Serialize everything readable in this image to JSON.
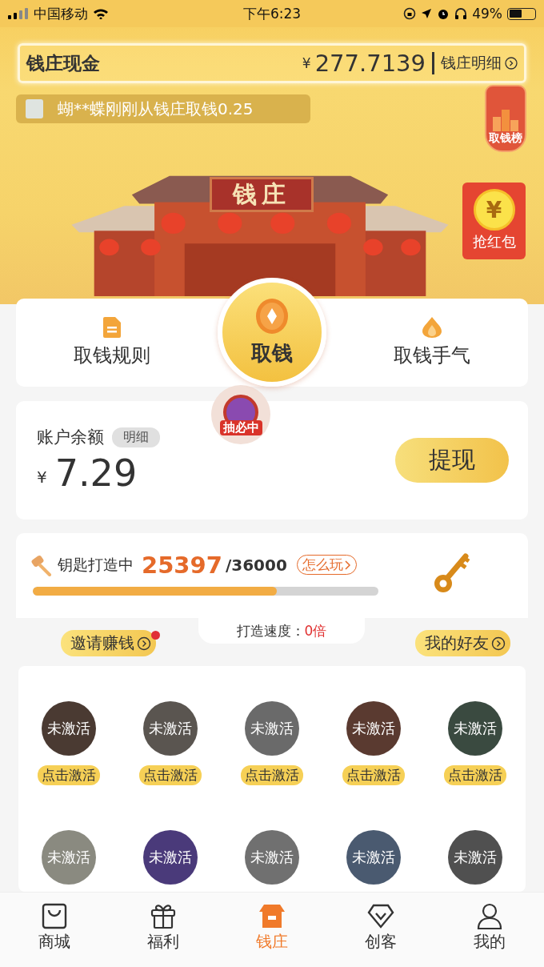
{
  "status_bar": {
    "carrier": "中国移动",
    "time": "下午6:23",
    "battery": "49%"
  },
  "header": {
    "title": "钱庄现金",
    "currency": "¥",
    "amount": "277.7139",
    "detail_link": "钱庄明细"
  },
  "ticker": {
    "text": "蝴**蝶刚刚从钱庄取钱0.25"
  },
  "rank_badge": {
    "label": "取钱榜"
  },
  "building": {
    "sign": "钱庄"
  },
  "red_packet": {
    "coin": "¥",
    "label": "抢红包"
  },
  "actions": [
    {
      "kind": "rules",
      "label": "取钱规则"
    },
    {
      "kind": "main",
      "label": "取钱"
    },
    {
      "kind": "luck",
      "label": "取钱手气"
    }
  ],
  "lottery_badge": {
    "label": "抽必中"
  },
  "balance": {
    "label": "账户余额",
    "detail": "明细",
    "currency": "¥",
    "amount": "7.29",
    "button": "提现"
  },
  "key_forge": {
    "title": "钥匙打造中",
    "current": "25397",
    "total": "/36000",
    "help": "怎么玩",
    "level": 0.7055,
    "speed_label": "打造速度：",
    "speed": "0倍"
  },
  "invite": {
    "label": "邀请赚钱",
    "has_dot": true
  },
  "friends_link": {
    "label": "我的好友"
  },
  "friends": [
    {
      "status": "未激活",
      "action": "点击激活"
    },
    {
      "status": "未激活",
      "action": "点击激活"
    },
    {
      "status": "未激活",
      "action": "点击激活"
    },
    {
      "status": "未激活",
      "action": "点击激活"
    },
    {
      "status": "未激活",
      "action": "点击激活"
    },
    {
      "status": "未激活"
    },
    {
      "status": "未激活"
    },
    {
      "status": "未激活"
    },
    {
      "status": "未激活"
    },
    {
      "status": "未激活"
    }
  ],
  "tab_bar": [
    {
      "kind": "shop",
      "label": "商城",
      "selected": false
    },
    {
      "kind": "gift",
      "label": "福利",
      "selected": false
    },
    {
      "kind": "bank",
      "label": "钱庄",
      "selected": true
    },
    {
      "kind": "diamond",
      "label": "创客",
      "selected": false
    },
    {
      "kind": "user",
      "label": "我的",
      "selected": false
    }
  ]
}
